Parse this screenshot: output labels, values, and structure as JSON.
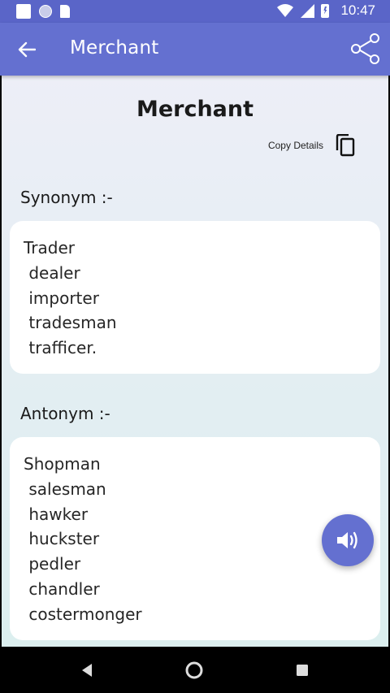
{
  "status_bar": {
    "time": "10:47",
    "icons": [
      "notification-square-icon",
      "notification-circle-icon",
      "sd-card-icon",
      "wifi-icon",
      "signal-icon",
      "battery-charging-icon"
    ]
  },
  "app_bar": {
    "title": "Merchant",
    "back_icon": "arrow-left-icon",
    "share_icon": "share-icon"
  },
  "main": {
    "word": "Merchant",
    "copy_label": "Copy Details",
    "synonym": {
      "title": "Synonym :-",
      "items": [
        "Trader",
        " dealer",
        " importer",
        " tradesman",
        " trafficer."
      ]
    },
    "antonym": {
      "title": "Antonym :-",
      "items": [
        "Shopman",
        " salesman",
        " hawker",
        " huckster",
        " pedler",
        " chandler",
        " costermonger"
      ]
    }
  },
  "fab_icon": "speaker-icon",
  "nav_bar": {
    "icons": [
      "back-triangle-icon",
      "home-circle-icon",
      "recents-square-icon"
    ]
  },
  "colors": {
    "primary": "#6470d0",
    "status_bar": "#5a65c8",
    "card": "#ffffff"
  }
}
